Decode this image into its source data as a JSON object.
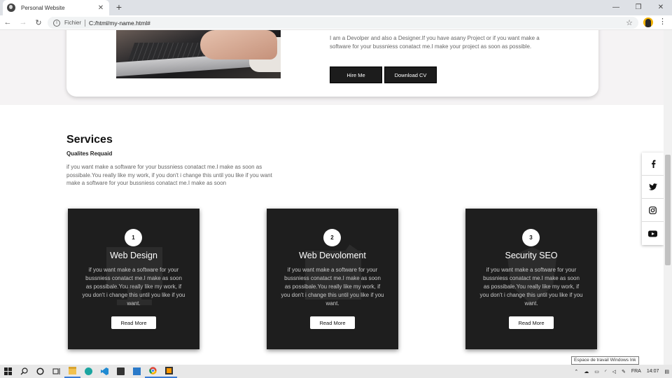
{
  "browser": {
    "tab_title": "Personal Website",
    "tab_close": "✕",
    "new_tab": "+",
    "omnibox_label": "Fichier",
    "url": "C:/html/my-name.html#",
    "window_controls": [
      "—",
      "❐",
      "✕"
    ]
  },
  "hero": {
    "about_text": "I am a Devolper and also a Designer.If you have asany Project or if you want make a software for your bussniess conatact me.I make your project as soon as possible.",
    "hire_label": "Hire Me",
    "cv_label": "Download CV"
  },
  "services": {
    "title": "Services",
    "subtitle": "Qualites Requaid",
    "description": "if you want make a software for your bussniess conatact me.I make as soon as possibale.You really like my work, if you don't i change this until you like if you want make a software for your bussniess conatact me.I make as soon",
    "cards": [
      {
        "number": "1",
        "title": "Web Design",
        "text": "if you want make a software for your bussniess conatact me.I make as soon as possibale.You really like my work, if you don't i change this until you like if you want.",
        "button": "Read More"
      },
      {
        "number": "2",
        "title": "Web Devoloment",
        "text": "if you want make a software for your bussniess conatact me.I make as soon as possibale.You really like my work, if you don't i change this until you like if you want.",
        "button": "Read More"
      },
      {
        "number": "3",
        "title": "Security SEO",
        "text": "if you want make a software for your bussniess conatact me.I make as soon as possibale.You really like my work, if you don't i change this until you like if you want.",
        "button": "Read More"
      }
    ]
  },
  "social": {
    "icons": [
      "facebook-icon",
      "twitter-icon",
      "instagram-icon",
      "youtube-icon"
    ]
  },
  "tooltip": "Espace de travail Windows Ink",
  "taskbar": {
    "language": "FRA",
    "time": "14:07"
  },
  "colors": {
    "card_bg": "#1e1e1e",
    "button_dark": "#1c1c1c",
    "page_bg_band": "#f5f3f4"
  }
}
